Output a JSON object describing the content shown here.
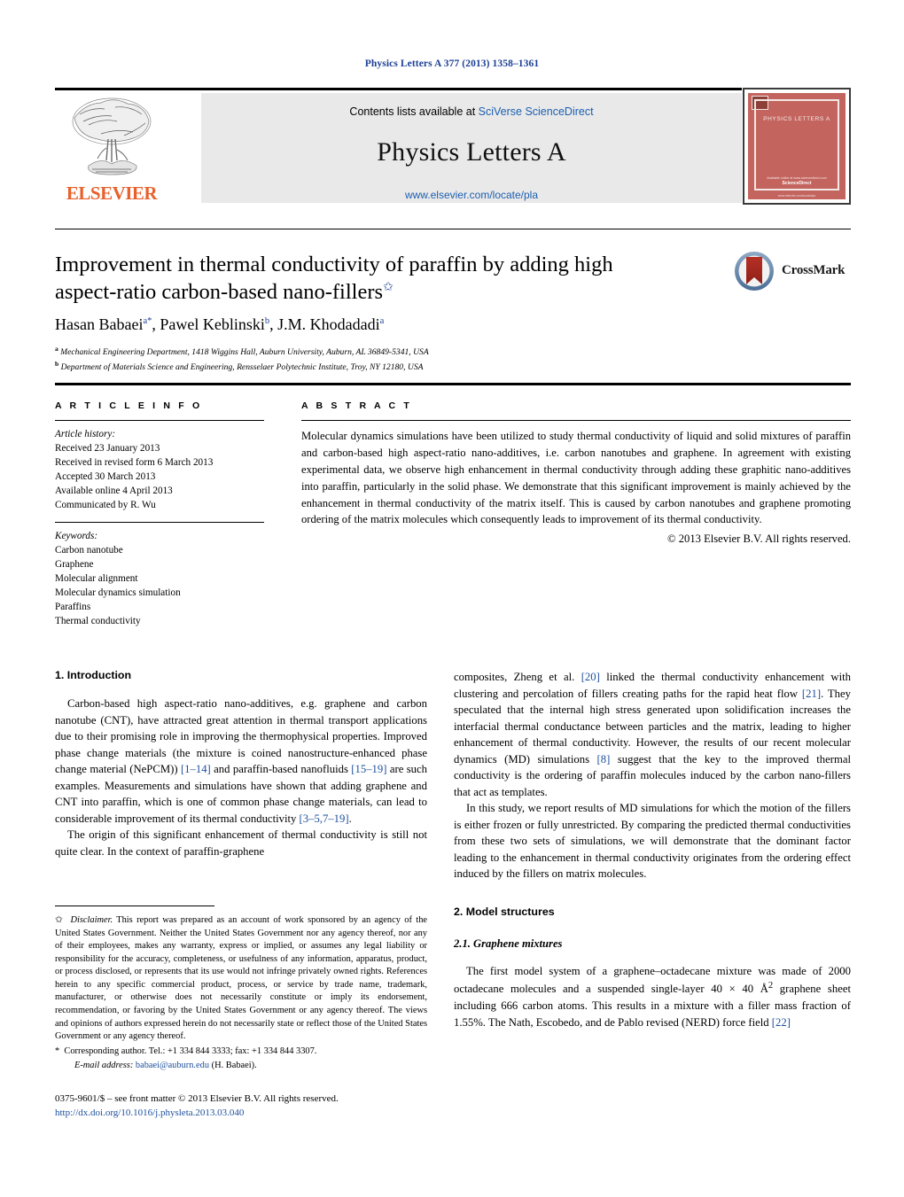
{
  "running_head": "Physics Letters A 377 (2013) 1358–1361",
  "masthead": {
    "publisher_wordmark": "ELSEVIER",
    "contents_prefix": "Contents lists available at ",
    "contents_link": "SciVerse ScienceDirect",
    "journal_title": "Physics Letters A",
    "journal_url": "www.elsevier.com/locate/pla",
    "cover": {
      "title": "PHYSICS LETTERS A",
      "foot_small": "Available online at www.sciencedirect.com",
      "foot_brand": "ScienceDirect",
      "foot_tiny": "www.elsevier.com/locate/pla"
    }
  },
  "article": {
    "title_line1": "Improvement in thermal conductivity of paraffin by adding high",
    "title_line2": "aspect-ratio carbon-based nano-fillers",
    "title_footnote_mark": "✩",
    "crossmark_label": "CrossMark",
    "authors": [
      {
        "name": "Hasan Babaei",
        "affil": "a",
        "corresponding": "*"
      },
      {
        "name": "Pawel Keblinski",
        "affil": "b",
        "corresponding": ""
      },
      {
        "name": "J.M. Khodadadi",
        "affil": "a",
        "corresponding": ""
      }
    ],
    "affiliations": [
      {
        "mark": "a",
        "text": "Mechanical Engineering Department, 1418 Wiggins Hall, Auburn University, Auburn, AL 36849-5341, USA"
      },
      {
        "mark": "b",
        "text": "Department of Materials Science and Engineering, Rensselaer Polytechnic Institute, Troy, NY 12180, USA"
      }
    ]
  },
  "info": {
    "heading": "A R T I C L E    I N F O",
    "history_label": "Article history:",
    "history": [
      "Received 23 January 2013",
      "Received in revised form 6 March 2013",
      "Accepted 30 March 2013",
      "Available online 4 April 2013",
      "Communicated by R. Wu"
    ],
    "keywords_label": "Keywords:",
    "keywords": [
      "Carbon nanotube",
      "Graphene",
      "Molecular alignment",
      "Molecular dynamics simulation",
      "Paraffins",
      "Thermal conductivity"
    ]
  },
  "abstract": {
    "heading": "A B S T R A C T",
    "text": "Molecular dynamics simulations have been utilized to study thermal conductivity of liquid and solid mixtures of paraffin and carbon-based high aspect-ratio nano-additives, i.e. carbon nanotubes and graphene. In agreement with existing experimental data, we observe high enhancement in thermal conductivity through adding these graphitic nano-additives into paraffin, particularly in the solid phase. We demonstrate that this significant improvement is mainly achieved by the enhancement in thermal conductivity of the matrix itself. This is caused by carbon nanotubes and graphene promoting ordering of the matrix molecules which consequently leads to improvement of its thermal conductivity.",
    "copyright": "© 2013 Elsevier B.V. All rights reserved."
  },
  "body": {
    "section1_heading": "1. Introduction",
    "section1_p1_a": "Carbon-based high aspect-ratio nano-additives, e.g. graphene and carbon nanotube (CNT), have attracted great attention in thermal transport applications due to their promising role in improving the thermophysical properties. Improved phase change materials (the mixture is coined nanostructure-enhanced phase change material (NePCM)) ",
    "section1_p1_ref1": "[1–14]",
    "section1_p1_b": " and paraffin-based nanofluids ",
    "section1_p1_ref2": "[15–19]",
    "section1_p1_c": " are such examples. Measurements and simulations have shown that adding graphene and CNT into paraffin, which is one of common phase change materials, can lead to considerable improvement of its thermal conductivity ",
    "section1_p1_ref3": "[3–5,7–19]",
    "section1_p1_d": ".",
    "section1_p2": "The origin of this significant enhancement of thermal conductivity is still not quite clear. In the context of paraffin-graphene",
    "section1_p3_a": "composites, Zheng et al. ",
    "section1_p3_ref1": "[20]",
    "section1_p3_b": " linked the thermal conductivity enhancement with clustering and percolation of fillers creating paths for the rapid heat flow ",
    "section1_p3_ref2": "[21]",
    "section1_p3_c": ". They speculated that the internal high stress generated upon solidification increases the interfacial thermal conductance between particles and the matrix, leading to higher enhancement of thermal conductivity. However, the results of our recent molecular dynamics (MD) simulations ",
    "section1_p3_ref3": "[8]",
    "section1_p3_d": " suggest that the key to the improved thermal conductivity is the ordering of paraffin molecules induced by the carbon nano-fillers that act as templates.",
    "section1_p4": "In this study, we report results of MD simulations for which the motion of the fillers is either frozen or fully unrestricted. By comparing the predicted thermal conductivities from these two sets of simulations, we will demonstrate that the dominant factor leading to the enhancement in thermal conductivity originates from the ordering effect induced by the fillers on matrix molecules.",
    "section2_heading": "2. Model structures",
    "section2_1_heading": "2.1. Graphene mixtures",
    "section2_1_p1_a": "The first model system of a graphene–octadecane mixture was made of 2000 octadecane molecules and a suspended single-layer 40 × 40 Å",
    "section2_1_p1_sup": "2",
    "section2_1_p1_b": " graphene sheet including 666 carbon atoms. This results in a mixture with a filler mass fraction of 1.55%. The Nath, Escobedo, and de Pablo revised (NERD) force field ",
    "section2_1_p1_ref": "[22]"
  },
  "footnotes": {
    "disclaimer_mark": "✩",
    "disclaimer_label": "Disclaimer.",
    "disclaimer_text": " This report was prepared as an account of work sponsored by an agency of the United States Government. Neither the United States Government nor any agency thereof, nor any of their employees, makes any warranty, express or implied, or assumes any legal liability or responsibility for the accuracy, completeness, or usefulness of any information, apparatus, product, or process disclosed, or represents that its use would not infringe privately owned rights. References herein to any specific commercial product, process, or service by trade name, trademark, manufacturer, or otherwise does not necessarily constitute or imply its endorsement, recommendation, or favoring by the United States Government or any agency thereof. The views and opinions of authors expressed herein do not necessarily state or reflect those of the United States Government or any agency thereof.",
    "corresponding_mark": "*",
    "corresponding_text": "Corresponding author. Tel.: +1 334 844 3333; fax: +1 334 844 3307.",
    "email_label": "E-mail address:",
    "email": "babaei@auburn.edu",
    "email_owner": "(H. Babaei)."
  },
  "imprint": {
    "issn_line": "0375-9601/$ – see front matter © 2013 Elsevier B.V. All rights reserved.",
    "doi": "http://dx.doi.org/10.1016/j.physleta.2013.03.040"
  },
  "colors": {
    "link_blue": "#1c4f9c",
    "head_blue": "#1c3f94",
    "elsevier_orange": "#e8612c",
    "band_gray": "#e9e9e9",
    "cover_red": "#c4645e"
  }
}
